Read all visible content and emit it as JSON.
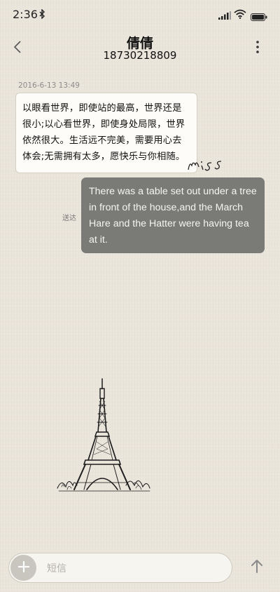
{
  "status_bar": {
    "time": "2:36",
    "icons": [
      "bluetooth-icon",
      "signal-icon",
      "wifi-icon",
      "battery-icon"
    ]
  },
  "header": {
    "contact_name": "倩倩",
    "contact_number": "18730218809",
    "back_icon": "back-chevron-icon",
    "more_icon": "more-vertical-icon"
  },
  "conversation": {
    "timestamp": "2016-6-13 13:49",
    "incoming_message": "以眼看世界，即使站的最高，世界还是很小;以心看世界，即使身处局限，世界依然很大。生活远不完美，需要用心去体会;无需拥有太多，愿快乐与你相随。",
    "outgoing_status": "送达",
    "outgoing_message": "There was a table set out under a tree in front of the house,and the March Hare and the Hatter were having tea at it."
  },
  "wallpaper": {
    "doodle_text": "miss",
    "illustration": "eiffel-tower"
  },
  "composer": {
    "placeholder": "短信",
    "add_icon": "plus-icon",
    "send_icon": "send-arrow-icon"
  },
  "colors": {
    "background": "#ebe6dc",
    "incoming_bubble": "#fdfcf8",
    "outgoing_bubble": "#7a7a77"
  }
}
